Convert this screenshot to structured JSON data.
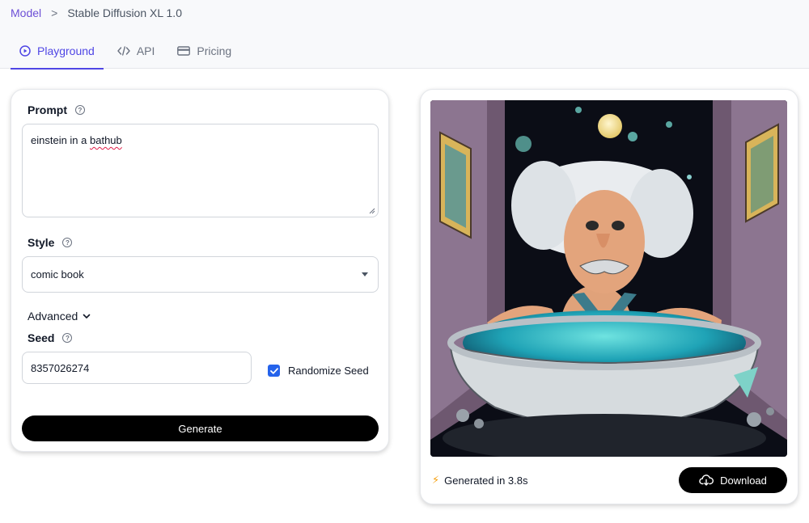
{
  "breadcrumb": {
    "root": "Model",
    "separator": ">",
    "current": "Stable Diffusion XL 1.0"
  },
  "tabs": [
    {
      "label": "Playground",
      "icon": "play-circle-icon",
      "active": true
    },
    {
      "label": "API",
      "icon": "code-icon",
      "active": false
    },
    {
      "label": "Pricing",
      "icon": "credit-card-icon",
      "active": false
    }
  ],
  "form": {
    "prompt_label": "Prompt",
    "prompt_value_word1": "einstein in a ",
    "prompt_value_word2": "bathub",
    "style_label": "Style",
    "style_value": "comic book",
    "advanced_label": "Advanced",
    "seed_label": "Seed",
    "seed_value": "8357026274",
    "randomize_label": "Randomize Seed",
    "randomize_checked": true,
    "generate_label": "Generate"
  },
  "result": {
    "status_icon": "⚡",
    "status_text": "Generated in 3.8s",
    "download_label": "Download"
  },
  "colors": {
    "accent": "#4f46e5",
    "breadcrumb_link": "#6d4fd6",
    "checkbox": "#2563eb",
    "button_bg": "#000000"
  }
}
